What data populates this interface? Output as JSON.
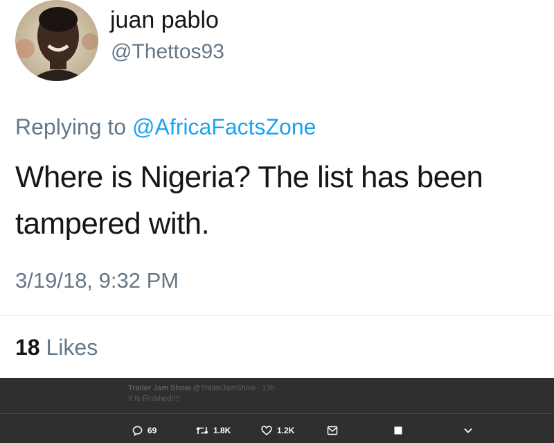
{
  "tweet": {
    "author_name": "juan pablo",
    "author_handle": "@Thettos93",
    "reply_prefix": "Replying to ",
    "reply_mention": "@AfricaFactsZone",
    "text": "Where is Nigeria? The list has been tampered with.",
    "timestamp": "3/19/18, 9:32 PM",
    "likes_count": "18",
    "likes_label": "Likes"
  },
  "bottom_bar": {
    "ghost_author": "Trailer Jam Show",
    "ghost_handle": "@TrailerJamShow · 13h",
    "ghost_text": "It Is Finished!!!!",
    "actions": {
      "reply_count": "69",
      "retweet_count": "1.8K",
      "like_count": "1.2K"
    }
  },
  "icons": {
    "reply": "reply-icon",
    "retweet": "retweet-icon",
    "like": "heart-icon",
    "dm": "mail-icon",
    "bookmark": "square-icon",
    "more": "chevron-down-icon"
  },
  "colors": {
    "text": "#14171a",
    "secondary": "#657786",
    "link": "#1da1f2",
    "bar": "#2f2f2f"
  }
}
